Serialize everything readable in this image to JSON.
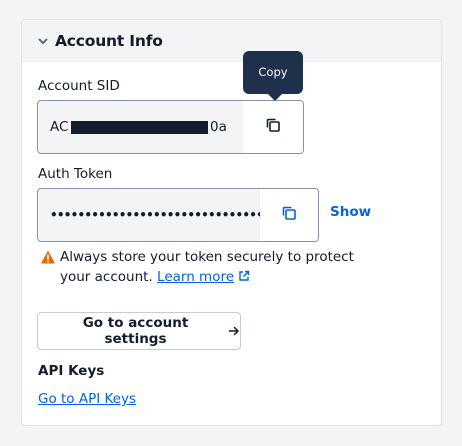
{
  "colors": {
    "link": "#0263e0",
    "text": "#121c2d",
    "warning": "#e26b0a",
    "tooltip_bg": "#1f304c",
    "field_bg": "#f4f4f6",
    "field_border": "#8891aa"
  },
  "card": {
    "title": "Account Info",
    "collapse_icon": "chevron-down-icon"
  },
  "account_sid": {
    "label": "Account SID",
    "value_prefix": "AC",
    "value_suffix": "0a",
    "copy_icon": "copy-icon",
    "tooltip": "Copy"
  },
  "auth_token": {
    "label": "Auth Token",
    "masked_value": "••••••••••••••••••••••••••••••••",
    "copy_icon": "copy-icon",
    "show_label": "Show"
  },
  "warning": {
    "icon": "warning-icon",
    "text": "Always store your token securely to protect your account.",
    "link_label": "Learn more",
    "link_icon": "external-link-icon"
  },
  "settings_button": {
    "label": "Go to account settings",
    "icon": "arrow-right-icon"
  },
  "api_keys": {
    "title": "API Keys",
    "link_label": "Go to API Keys"
  }
}
